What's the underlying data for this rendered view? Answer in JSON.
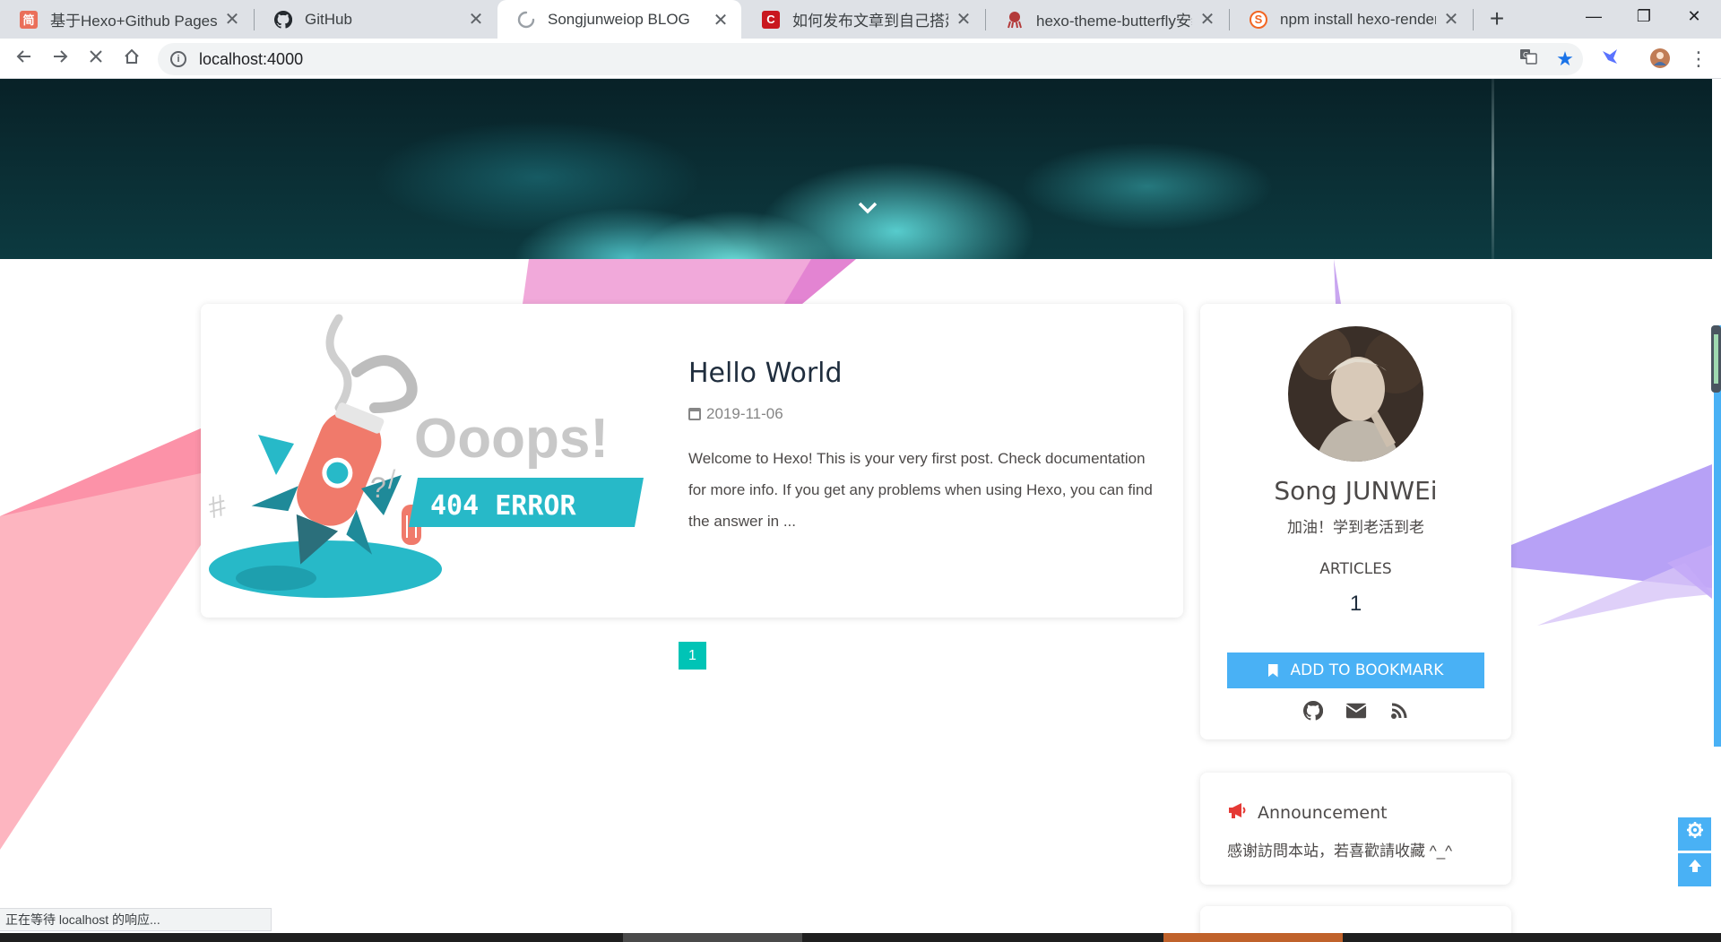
{
  "browser": {
    "tabs": [
      {
        "title": "基于Hexo+Github Pages的",
        "favicon_letter": "简",
        "favicon_color": "#ea6f5a",
        "active": false
      },
      {
        "title": "GitHub",
        "favicon_letter": "",
        "favicon_color": "#24292e",
        "active": false
      },
      {
        "title": "Songjunweiop BLOG",
        "favicon_letter": "",
        "favicon_color": "#9aa0a6",
        "active": true
      },
      {
        "title": "如何发布文章到自己搭建的h",
        "favicon_letter": "C",
        "favicon_color": "#c9171e",
        "active": false
      },
      {
        "title": "hexo-theme-butterfly安装",
        "favicon_letter": "",
        "favicon_color": "#b33a3a",
        "active": false
      },
      {
        "title": "npm install hexo-renderer",
        "favicon_letter": "S",
        "favicon_color": "#f26522",
        "active": false
      }
    ],
    "new_tab_label": "+",
    "window_controls": {
      "minimize": "—",
      "restore": "❐",
      "close": "✕"
    },
    "url": "localhost:4000",
    "status_text": "正在等待 localhost 的响应..."
  },
  "blog": {
    "post": {
      "title": "Hello World",
      "date": "2019-11-06",
      "excerpt": "Welcome to Hexo! This is your very first post. Check documentation for more info. If you get any problems when using Hexo, you can find the answer in ...",
      "cover_heading": "Ooops!",
      "cover_badge": "404 ERROR"
    },
    "pagination": {
      "current": "1"
    },
    "author": {
      "name": "Song JUNWEi",
      "description": "加油！学到老活到老",
      "articles_label": "ARTICLES",
      "articles_count": "1",
      "bookmark_label": "ADD TO BOOKMARK",
      "social_icons": [
        "github-icon",
        "envelope-icon",
        "rss-icon"
      ]
    },
    "announcement": {
      "title": "Announcement",
      "text": "感谢訪問本站，若喜歡請收藏 ^_^"
    },
    "colors": {
      "accent": "#49b1f5",
      "pagination": "#00c4b6",
      "text": "#4c4948",
      "announcement_icon": "#ff0000"
    }
  }
}
